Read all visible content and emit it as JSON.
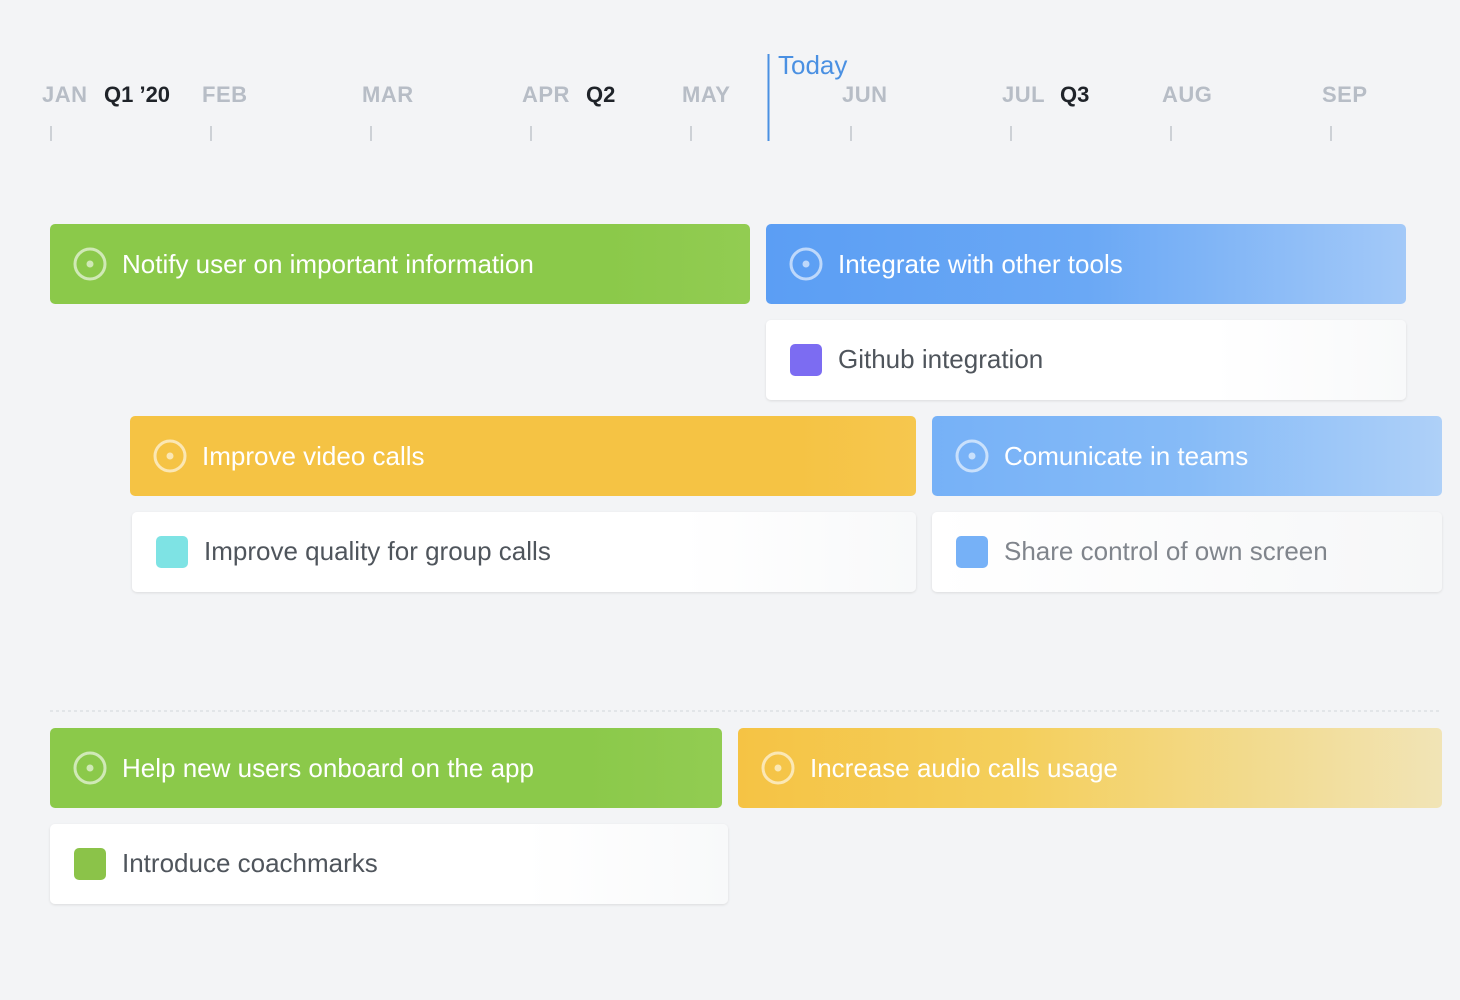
{
  "timeline": {
    "months": [
      "JAN",
      "FEB",
      "MAR",
      "APR",
      "MAY",
      "JUN",
      "JUL",
      "AUG",
      "SEP"
    ],
    "quarters": [
      "Q1 ’20",
      "Q2",
      "Q3"
    ],
    "today_label": "Today"
  },
  "lanes": [
    {
      "goals": [
        {
          "label": "Notify user on important information",
          "color": "#8bc34a"
        },
        {
          "label": "Integrate with other tools",
          "color": "#5b9ef4",
          "items": [
            {
              "label": "Github integration",
              "color": "#7b6cf2"
            }
          ]
        },
        {
          "label": "Improve video calls",
          "color": "#f5c344",
          "items": [
            {
              "label": "Improve quality for group calls",
              "color": "#7ee3e4"
            }
          ]
        },
        {
          "label": "Comunicate in teams",
          "color": "#76b1f7",
          "items": [
            {
              "label": "Share control of own screen",
              "color": "#76b1f7"
            }
          ]
        }
      ]
    },
    {
      "goals": [
        {
          "label": "Help new users onboard on the app",
          "color": "#8bc34a",
          "items": [
            {
              "label": "Introduce coachmarks",
              "color": "#8bc34a"
            }
          ]
        },
        {
          "label": "Increase audio calls usage",
          "color": "#f5c344"
        }
      ]
    }
  ],
  "icons": {
    "goal": "target-icon",
    "item": "square-icon"
  }
}
